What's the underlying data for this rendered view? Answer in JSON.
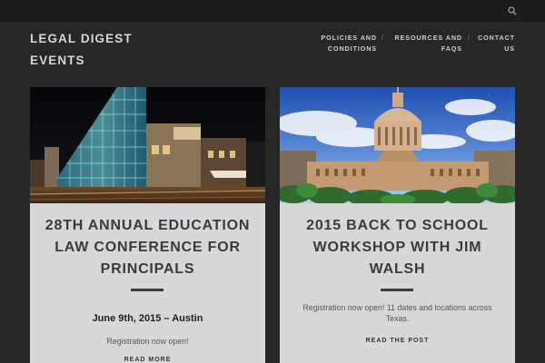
{
  "site": {
    "title": "LEGAL DIGEST EVENTS"
  },
  "header": {
    "search_icon": "search-icon",
    "nav": [
      {
        "line1": "POLICIES AND",
        "line2": "CONDITIONS"
      },
      {
        "line1": "RESOURCES AND",
        "line2": "FAQS"
      },
      {
        "line1": "CONTACT",
        "line2": "US"
      }
    ],
    "separator": "/"
  },
  "posts": [
    {
      "title": "28TH ANNUAL EDUCATION LAW CONFERENCE FOR PRINCIPALS",
      "date": "June 9th, 2015 – Austin",
      "excerpt": "Registration now open!",
      "link_label": "READ MORE"
    },
    {
      "title": "2015 BACK TO SCHOOL WORKSHOP WITH JIM WALSH",
      "excerpt": "Registration now open!  11 dates and locations across Texas.",
      "link_label": "READ THE POST"
    }
  ],
  "colors": {
    "background": "#262626",
    "topbar": "#1b1b1b",
    "card": "#d8d8d8",
    "title_text": "#3a3a3a"
  }
}
